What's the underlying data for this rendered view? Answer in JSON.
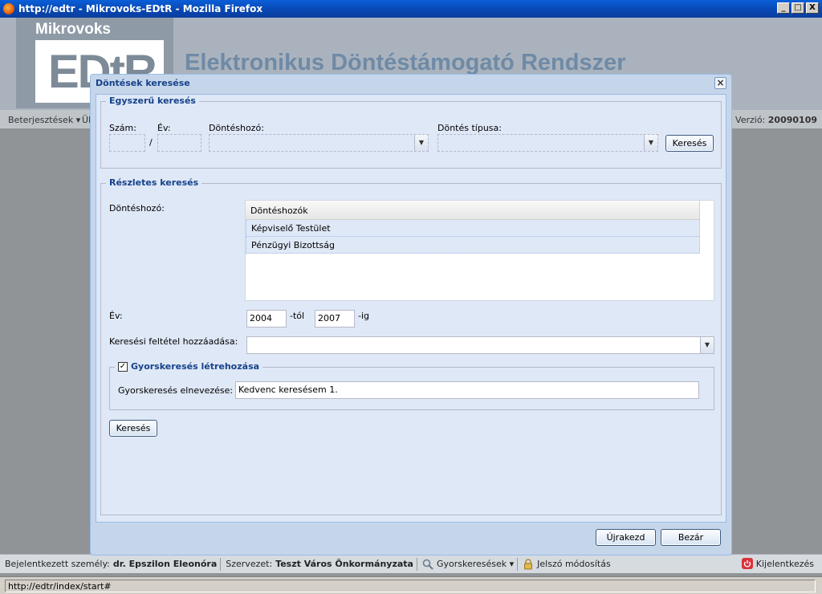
{
  "window": {
    "title": "http://edtr - Mikrovoks-EDtR - Mozilla Firefox",
    "minimize": "_",
    "maximize": "□",
    "close": "X",
    "status_url": "http://edtr/index/start#"
  },
  "app": {
    "logo_top": "Mikrovoks",
    "logo_main": "EDtR",
    "title": "Elektronikus Döntéstámogató Rendszer",
    "toolbar": {
      "beterjesztesek": "Beterjesztések ▾",
      "truncated_item": "Ül",
      "version_label": "Verzió:",
      "version_value": "20090109"
    },
    "footer": {
      "user_label": "Bejelentkezett személy:",
      "user_value": "dr. Epszilon Eleonóra",
      "org_label": "Szervezet:",
      "org_value": "Teszt Város Önkormányzata",
      "quick_search": "Gyorskeresések ▾",
      "password": "Jelszó módosítás",
      "logout": "Kijelentkezés"
    }
  },
  "dialog": {
    "title": "Döntések keresése",
    "close": "×",
    "simple": {
      "legend": "Egyszerű keresés",
      "szam_label": "Szám:",
      "ev_label": "Év:",
      "slash": "/",
      "dontéshozo_label": "Döntéshozó:",
      "tipus_label": "Döntés típusa:",
      "search_button": "Keresés"
    },
    "detailed": {
      "legend": "Részletes keresés",
      "dontéshozo_label": "Döntéshozó:",
      "grid_header": "Döntéshozók",
      "grid_rows": [
        "Képviselő Testület",
        "Pénzügyi Bizottság"
      ],
      "ev_label": "Év:",
      "year_from": "2004",
      "from_suffix": "-tól",
      "year_to": "2007",
      "to_suffix": "-ig",
      "add_condition_label": "Keresési feltétel hozzáadása:",
      "quick": {
        "legend": "Gyorskeresés létrehozása",
        "checked": "✓",
        "name_label": "Gyorskeresés elnevezése:",
        "name_value": "Kedvenc keresésem 1."
      },
      "search_button": "Keresés"
    },
    "reset_button": "Újrakezd",
    "close_button": "Bezár"
  },
  "icons": {
    "combo_trigger": "combo-down-arrow",
    "search": "magnifier-icon",
    "lock": "lock-icon",
    "power": "power-icon"
  }
}
